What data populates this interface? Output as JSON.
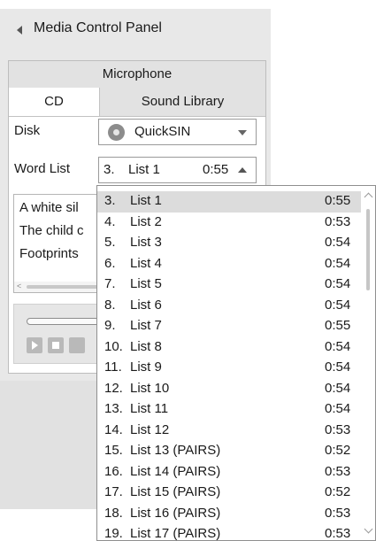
{
  "panel": {
    "title": "Media Control Panel",
    "tabs": {
      "microphone": "Microphone",
      "cd": "CD",
      "sound_library": "Sound Library"
    }
  },
  "disk": {
    "label": "Disk",
    "value": "QuickSIN"
  },
  "word_list": {
    "label": "Word List",
    "selected_number": "3.",
    "selected_name": "List 1",
    "selected_duration": "0:55"
  },
  "sentences": [
    "A white sil",
    "The child c",
    "Footprints"
  ],
  "dropdown": {
    "options": [
      {
        "number": "3.",
        "name": "List 1",
        "duration": "0:55"
      },
      {
        "number": "4.",
        "name": "List 2",
        "duration": "0:53"
      },
      {
        "number": "5.",
        "name": "List 3",
        "duration": "0:54"
      },
      {
        "number": "6.",
        "name": "List 4",
        "duration": "0:54"
      },
      {
        "number": "7.",
        "name": "List 5",
        "duration": "0:54"
      },
      {
        "number": "8.",
        "name": "List 6",
        "duration": "0:54"
      },
      {
        "number": "9.",
        "name": "List 7",
        "duration": "0:55"
      },
      {
        "number": "10.",
        "name": "List 8",
        "duration": "0:54"
      },
      {
        "number": "11.",
        "name": "List 9",
        "duration": "0:54"
      },
      {
        "number": "12.",
        "name": "List 10",
        "duration": "0:54"
      },
      {
        "number": "13.",
        "name": "List 11",
        "duration": "0:54"
      },
      {
        "number": "14.",
        "name": "List 12",
        "duration": "0:53"
      },
      {
        "number": "15.",
        "name": "List 13 (PAIRS)",
        "duration": "0:52"
      },
      {
        "number": "16.",
        "name": "List 14 (PAIRS)",
        "duration": "0:53"
      },
      {
        "number": "17.",
        "name": "List 15 (PAIRS)",
        "duration": "0:52"
      },
      {
        "number": "18.",
        "name": "List 16 (PAIRS)",
        "duration": "0:53"
      },
      {
        "number": "19.",
        "name": "List 17 (PAIRS)",
        "duration": "0:53"
      }
    ]
  },
  "icons": {
    "collapse": "collapse-left-icon",
    "disc": "disc-icon",
    "play": "play-icon",
    "stop": "stop-icon"
  }
}
